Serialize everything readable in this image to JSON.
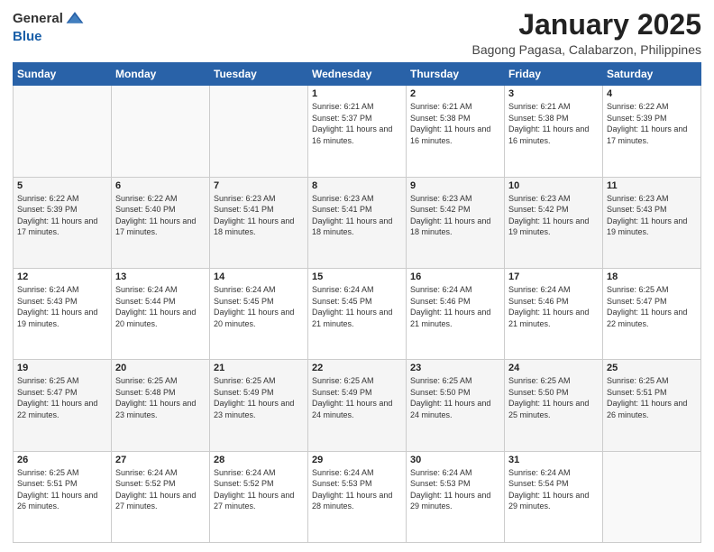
{
  "logo": {
    "general": "General",
    "blue": "Blue"
  },
  "header": {
    "title": "January 2025",
    "subtitle": "Bagong Pagasa, Calabarzon, Philippines"
  },
  "weekdays": [
    "Sunday",
    "Monday",
    "Tuesday",
    "Wednesday",
    "Thursday",
    "Friday",
    "Saturday"
  ],
  "weeks": [
    [
      {
        "day": "",
        "sunrise": "",
        "sunset": "",
        "daylight": ""
      },
      {
        "day": "",
        "sunrise": "",
        "sunset": "",
        "daylight": ""
      },
      {
        "day": "",
        "sunrise": "",
        "sunset": "",
        "daylight": ""
      },
      {
        "day": "1",
        "sunrise": "6:21 AM",
        "sunset": "5:37 PM",
        "daylight": "11 hours and 16 minutes."
      },
      {
        "day": "2",
        "sunrise": "6:21 AM",
        "sunset": "5:38 PM",
        "daylight": "11 hours and 16 minutes."
      },
      {
        "day": "3",
        "sunrise": "6:21 AM",
        "sunset": "5:38 PM",
        "daylight": "11 hours and 16 minutes."
      },
      {
        "day": "4",
        "sunrise": "6:22 AM",
        "sunset": "5:39 PM",
        "daylight": "11 hours and 17 minutes."
      }
    ],
    [
      {
        "day": "5",
        "sunrise": "6:22 AM",
        "sunset": "5:39 PM",
        "daylight": "11 hours and 17 minutes."
      },
      {
        "day": "6",
        "sunrise": "6:22 AM",
        "sunset": "5:40 PM",
        "daylight": "11 hours and 17 minutes."
      },
      {
        "day": "7",
        "sunrise": "6:23 AM",
        "sunset": "5:41 PM",
        "daylight": "11 hours and 18 minutes."
      },
      {
        "day": "8",
        "sunrise": "6:23 AM",
        "sunset": "5:41 PM",
        "daylight": "11 hours and 18 minutes."
      },
      {
        "day": "9",
        "sunrise": "6:23 AM",
        "sunset": "5:42 PM",
        "daylight": "11 hours and 18 minutes."
      },
      {
        "day": "10",
        "sunrise": "6:23 AM",
        "sunset": "5:42 PM",
        "daylight": "11 hours and 19 minutes."
      },
      {
        "day": "11",
        "sunrise": "6:23 AM",
        "sunset": "5:43 PM",
        "daylight": "11 hours and 19 minutes."
      }
    ],
    [
      {
        "day": "12",
        "sunrise": "6:24 AM",
        "sunset": "5:43 PM",
        "daylight": "11 hours and 19 minutes."
      },
      {
        "day": "13",
        "sunrise": "6:24 AM",
        "sunset": "5:44 PM",
        "daylight": "11 hours and 20 minutes."
      },
      {
        "day": "14",
        "sunrise": "6:24 AM",
        "sunset": "5:45 PM",
        "daylight": "11 hours and 20 minutes."
      },
      {
        "day": "15",
        "sunrise": "6:24 AM",
        "sunset": "5:45 PM",
        "daylight": "11 hours and 21 minutes."
      },
      {
        "day": "16",
        "sunrise": "6:24 AM",
        "sunset": "5:46 PM",
        "daylight": "11 hours and 21 minutes."
      },
      {
        "day": "17",
        "sunrise": "6:24 AM",
        "sunset": "5:46 PM",
        "daylight": "11 hours and 21 minutes."
      },
      {
        "day": "18",
        "sunrise": "6:25 AM",
        "sunset": "5:47 PM",
        "daylight": "11 hours and 22 minutes."
      }
    ],
    [
      {
        "day": "19",
        "sunrise": "6:25 AM",
        "sunset": "5:47 PM",
        "daylight": "11 hours and 22 minutes."
      },
      {
        "day": "20",
        "sunrise": "6:25 AM",
        "sunset": "5:48 PM",
        "daylight": "11 hours and 23 minutes."
      },
      {
        "day": "21",
        "sunrise": "6:25 AM",
        "sunset": "5:49 PM",
        "daylight": "11 hours and 23 minutes."
      },
      {
        "day": "22",
        "sunrise": "6:25 AM",
        "sunset": "5:49 PM",
        "daylight": "11 hours and 24 minutes."
      },
      {
        "day": "23",
        "sunrise": "6:25 AM",
        "sunset": "5:50 PM",
        "daylight": "11 hours and 24 minutes."
      },
      {
        "day": "24",
        "sunrise": "6:25 AM",
        "sunset": "5:50 PM",
        "daylight": "11 hours and 25 minutes."
      },
      {
        "day": "25",
        "sunrise": "6:25 AM",
        "sunset": "5:51 PM",
        "daylight": "11 hours and 26 minutes."
      }
    ],
    [
      {
        "day": "26",
        "sunrise": "6:25 AM",
        "sunset": "5:51 PM",
        "daylight": "11 hours and 26 minutes."
      },
      {
        "day": "27",
        "sunrise": "6:24 AM",
        "sunset": "5:52 PM",
        "daylight": "11 hours and 27 minutes."
      },
      {
        "day": "28",
        "sunrise": "6:24 AM",
        "sunset": "5:52 PM",
        "daylight": "11 hours and 27 minutes."
      },
      {
        "day": "29",
        "sunrise": "6:24 AM",
        "sunset": "5:53 PM",
        "daylight": "11 hours and 28 minutes."
      },
      {
        "day": "30",
        "sunrise": "6:24 AM",
        "sunset": "5:53 PM",
        "daylight": "11 hours and 29 minutes."
      },
      {
        "day": "31",
        "sunrise": "6:24 AM",
        "sunset": "5:54 PM",
        "daylight": "11 hours and 29 minutes."
      },
      {
        "day": "",
        "sunrise": "",
        "sunset": "",
        "daylight": ""
      }
    ]
  ],
  "labels": {
    "sunrise": "Sunrise:",
    "sunset": "Sunset:",
    "daylight": "Daylight:"
  }
}
